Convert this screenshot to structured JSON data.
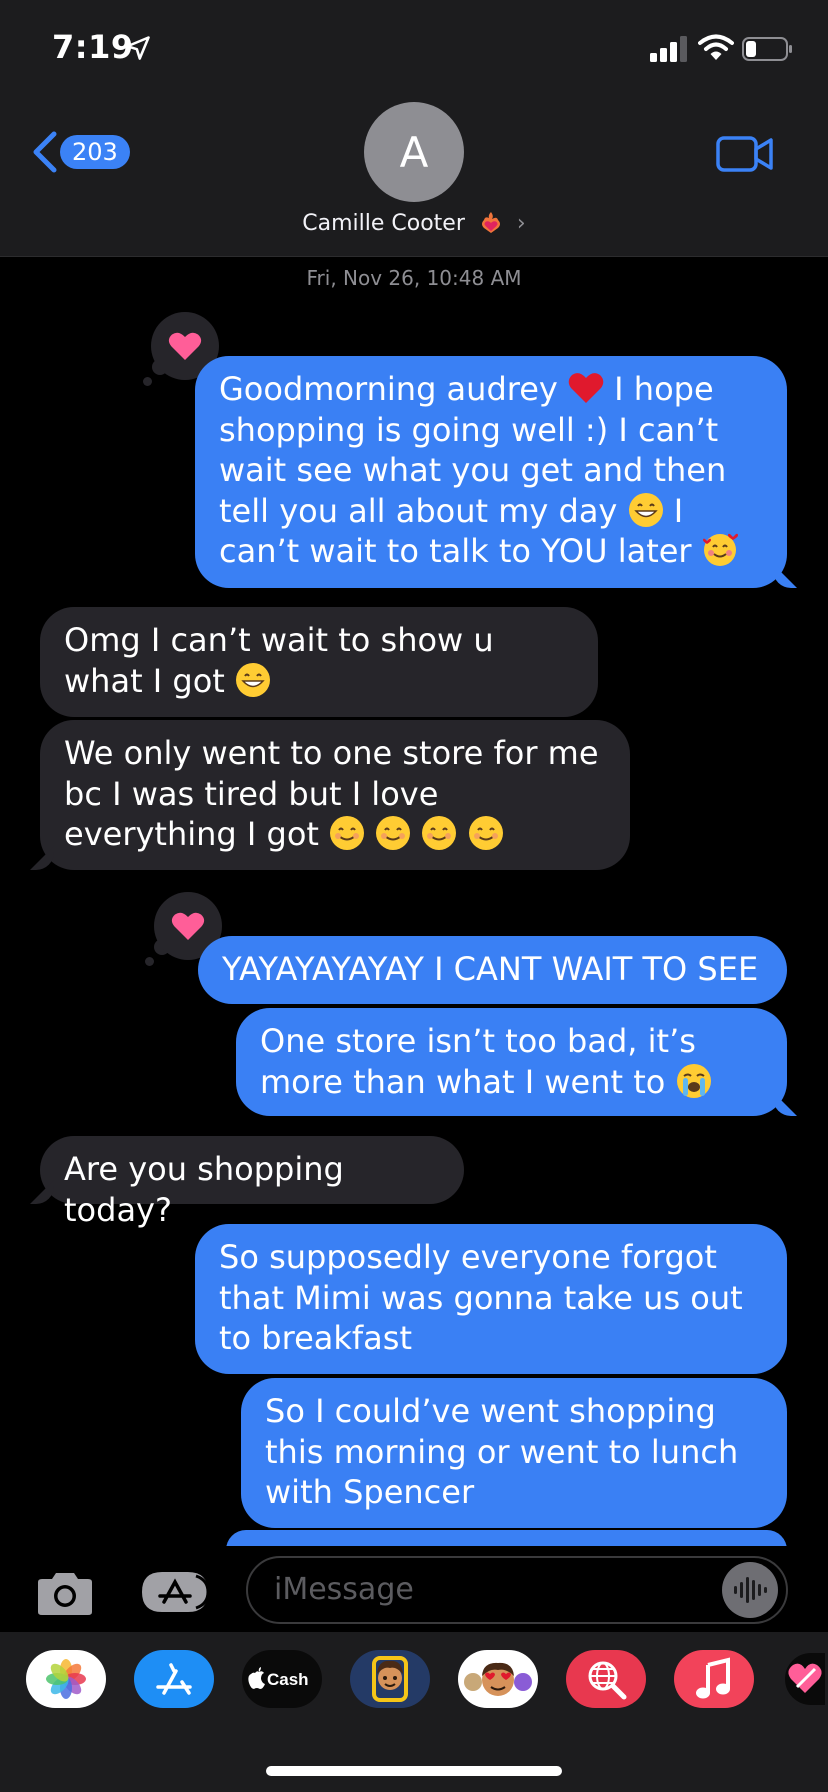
{
  "status_bar": {
    "time": "7:19"
  },
  "header": {
    "back_count": "203",
    "avatar_initial": "A",
    "contact_name": "Camille Cooter",
    "chevron": "›"
  },
  "date_stamp": "Fri, Nov 26, 10:48 AM",
  "messages": [
    {
      "from": "me",
      "parts": [
        "Goodmorning audrey",
        "I hope shopping is going well :) I can’t wait see what you get and then tell you all about my day",
        "I can’t wait to talk to YOU later"
      ],
      "tapback": "heart"
    },
    {
      "from": "them",
      "parts": [
        "Omg I can’t wait to show u what I got"
      ]
    },
    {
      "from": "them",
      "parts": [
        "We only went to one store for me bc I was tired but I love everything I got"
      ]
    },
    {
      "from": "me",
      "parts": [
        "YAYAYAYAYAY I CANT WAIT TO SEE"
      ],
      "tapback": "heart"
    },
    {
      "from": "me",
      "parts": [
        "One store isn’t too bad, it’s more than what I went to"
      ]
    },
    {
      "from": "them",
      "parts": [
        "Are you shopping today?"
      ]
    },
    {
      "from": "me",
      "parts": [
        "So supposedly everyone forgot that Mimi was gonna take us out to breakfast"
      ]
    },
    {
      "from": "me",
      "parts": [
        "So I could’ve went shopping this morning or went to lunch with Spencer"
      ]
    }
  ],
  "input": {
    "placeholder": "iMessage"
  },
  "app_drawer": [
    "photos-app",
    "app-store",
    "apple-cash",
    "memoji-stickers",
    "animoji",
    "images-search",
    "music",
    "digital-touch"
  ],
  "colors": {
    "sent_bubble": "#3a80f4",
    "received_bubble": "#26252a",
    "tapback_heart": "#ff5e98"
  }
}
